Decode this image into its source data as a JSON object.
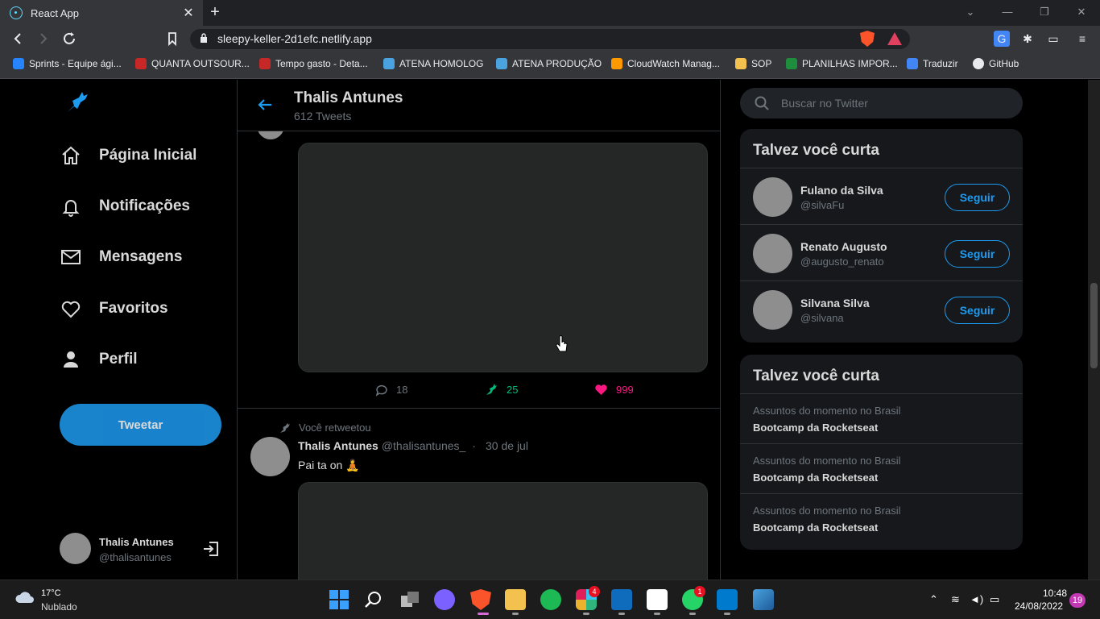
{
  "browser": {
    "tab_title": "React App",
    "url": "sleepy-keller-2d1efc.netlify.app",
    "bookmarks": [
      {
        "label": "Sprints - Equipe ági...",
        "color": "#2684ff"
      },
      {
        "label": "QUANTA OUTSOUR...",
        "color": "#c62828"
      },
      {
        "label": "Tempo gasto - Deta...",
        "color": "#c62828"
      },
      {
        "label": "ATENA HOMOLOG",
        "color": "#4aa3df"
      },
      {
        "label": "ATENA PRODUÇÃO",
        "color": "#4aa3df"
      },
      {
        "label": "CloudWatch Manag...",
        "color": "#ff9900"
      },
      {
        "label": "SOP",
        "color": "#f2c14e"
      },
      {
        "label": "PLANILHAS IMPOR...",
        "color": "#1e8e3e"
      },
      {
        "label": "Traduzir",
        "color": "#4285f4"
      },
      {
        "label": "GitHub",
        "color": "#e8eaed"
      }
    ]
  },
  "sidebar": {
    "menu": [
      {
        "label": "Página Inicial",
        "icon": "home-icon"
      },
      {
        "label": "Notificações",
        "icon": "bell-icon"
      },
      {
        "label": "Mensagens",
        "icon": "mail-icon"
      },
      {
        "label": "Favoritos",
        "icon": "heart-icon"
      },
      {
        "label": "Perfil",
        "icon": "person-icon"
      }
    ],
    "tweet_button": "Tweetar",
    "profile": {
      "name": "Thalis Antunes",
      "handle": "@thalisantunes"
    }
  },
  "feed": {
    "title": "Thalis Antunes",
    "subtitle": "612 Tweets",
    "tweet1": {
      "comments": "18",
      "retweets": "25",
      "likes": "999"
    },
    "tweet2": {
      "retweet_note": "Você retweetou",
      "author": "Thalis Antunes",
      "handle": "@thalisantunes_",
      "separator": "·",
      "date": "30 de jul",
      "text": "Pai ta on 🧘"
    }
  },
  "right": {
    "search_placeholder": "Buscar no Twitter",
    "suggestions": {
      "title": "Talvez você curta",
      "follow_label": "Seguir",
      "users": [
        {
          "name": "Fulano da Silva",
          "handle": "@silvaFu"
        },
        {
          "name": "Renato Augusto",
          "handle": "@augusto_renato"
        },
        {
          "name": "Silvana Silva",
          "handle": "@silvana"
        }
      ]
    },
    "trends": {
      "title": "Talvez você curta",
      "items": [
        {
          "context": "Assuntos do momento no Brasil",
          "topic": "Bootcamp da Rocketseat"
        },
        {
          "context": "Assuntos do momento no Brasil",
          "topic": "Bootcamp da Rocketseat"
        },
        {
          "context": "Assuntos do momento no Brasil",
          "topic": "Bootcamp da Rocketseat"
        }
      ]
    }
  },
  "taskbar": {
    "temperature": "17°C",
    "condition": "Nublado",
    "slack_badge": "4",
    "whatsapp_badge": "1",
    "time": "10:48",
    "date": "24/08/2022",
    "notifications": "19"
  },
  "colors": {
    "accent": "#1d9bf0",
    "retweet": "#00ba7c",
    "like": "#f91880",
    "background": "#000000"
  }
}
